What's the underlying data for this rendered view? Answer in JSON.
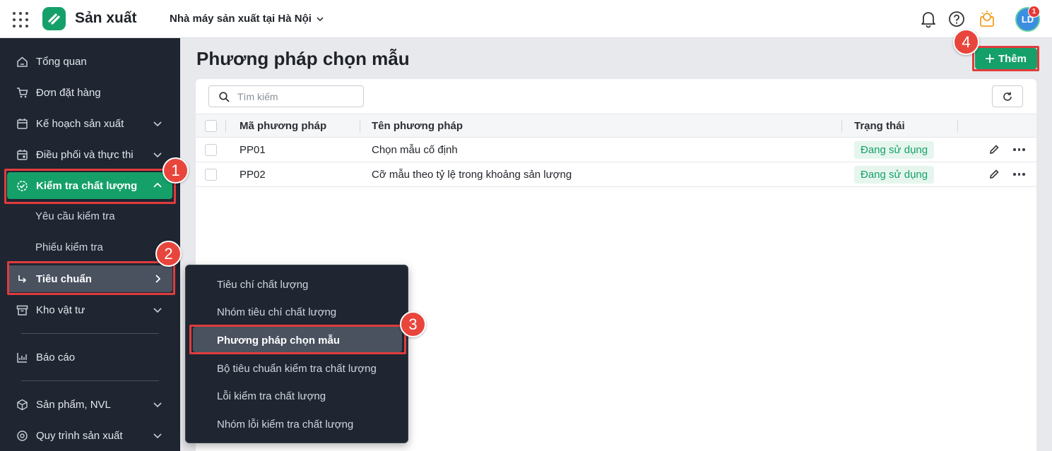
{
  "topbar": {
    "app_title": "Sản xuất",
    "factory": "Nhà máy sản xuất tại Hà Nội",
    "avatar_initials": "LD",
    "avatar_badge": "1"
  },
  "sidebar": {
    "items": [
      {
        "label": "Tổng quan",
        "icon": "home-icon"
      },
      {
        "label": "Đơn đặt hàng",
        "icon": "cart-icon"
      },
      {
        "label": "Kế hoạch sản xuất",
        "icon": "calendar-icon"
      },
      {
        "label": "Điều phối và thực thi",
        "icon": "calendar-settings-icon"
      },
      {
        "label": "Kiểm tra chất lượng",
        "icon": "quality-check-icon"
      },
      {
        "label": "Yêu cầu kiểm tra"
      },
      {
        "label": "Phiếu kiểm tra"
      },
      {
        "label": "Tiêu chuẩn",
        "icon": "arrow-turn-icon"
      },
      {
        "label": "Kho vật tư",
        "icon": "archive-icon"
      },
      {
        "label": "Báo cáo",
        "icon": "report-icon"
      },
      {
        "label": "Sản phẩm, NVL",
        "icon": "box-icon"
      },
      {
        "label": "Quy trình sản xuất",
        "icon": "process-icon"
      }
    ]
  },
  "flyout": {
    "items": [
      "Tiêu chí chất lượng",
      "Nhóm tiêu chí chất lượng",
      "Phương pháp chọn mẫu",
      "Bộ tiêu chuẩn kiểm tra chất lượng",
      "Lỗi kiểm tra chất lượng",
      "Nhóm lỗi kiểm tra chất lượng"
    ]
  },
  "main": {
    "title": "Phương pháp chọn mẫu",
    "add_label": "Thêm",
    "search_placeholder": "Tìm kiếm",
    "columns": [
      "Mã phương pháp",
      "Tên phương pháp",
      "Trạng thái"
    ],
    "rows": [
      {
        "code": "PP01",
        "name": "Chọn mẫu cố định",
        "status": "Đang sử dụng"
      },
      {
        "code": "PP02",
        "name": "Cỡ mẫu theo tỷ lệ trong khoảng sản lượng",
        "status": "Đang sử dụng"
      }
    ]
  },
  "annotations": [
    "1",
    "2",
    "3",
    "4"
  ],
  "colors": {
    "accent": "#15a06a",
    "sidebar": "#1f2632",
    "highlight": "#e03c3c"
  }
}
